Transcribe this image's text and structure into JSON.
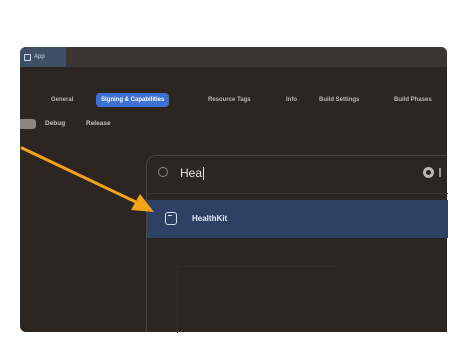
{
  "window": {
    "tab_label": "App"
  },
  "nav": {
    "items": [
      "General",
      "Signing & Capabilities",
      "Resource Tags",
      "Info",
      "Build Settings",
      "Build Phases"
    ],
    "active_index": 1
  },
  "config": {
    "items": [
      "Debug",
      "Release"
    ]
  },
  "popup": {
    "search_value": "Hea",
    "results": [
      {
        "label": "HealthKit",
        "icon": "healthkit-doc-icon"
      }
    ]
  },
  "colors": {
    "arrow": "#f5a318",
    "accent": "#3d71d6",
    "selection": "#2d4164"
  }
}
